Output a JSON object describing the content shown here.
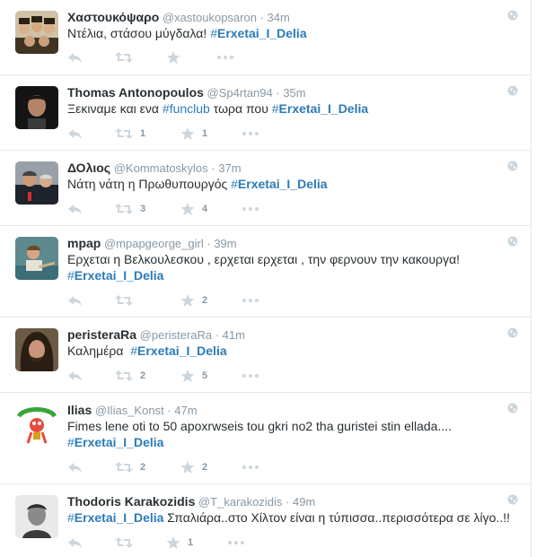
{
  "tweets": [
    {
      "fullname": "Χαστουκόψαρο",
      "username": "@xastoukopsaron",
      "time": "34m",
      "text_before": "Ντέλια, στάσου μύγδαλα! ",
      "hashtag1": "Erxetai_I_Delia",
      "text_middle": "",
      "hashtag2": "",
      "text_after": "",
      "retweets": "",
      "favorites": ""
    },
    {
      "fullname": "Thomas Antonopoulos",
      "username": "@Sp4rtan94",
      "time": "35m",
      "text_before": "Ξεκιναμε και ενα ",
      "hashtag1": "funclub",
      "text_middle": " τωρα που ",
      "hashtag2": "Erxetai_I_Delia",
      "text_after": "",
      "retweets": "1",
      "favorites": "1"
    },
    {
      "fullname": "ΔΟλιος",
      "username": "@Kommatoskylos",
      "time": "37m",
      "text_before": "Νάτη νάτη η Πρωθυπουργός ",
      "hashtag1": "Erxetai_I_Delia",
      "text_middle": "",
      "hashtag2": "",
      "text_after": "",
      "retweets": "3",
      "favorites": "4"
    },
    {
      "fullname": "mpap",
      "username": "@mpapgeorge_girl",
      "time": "39m",
      "text_before": "Ερχεται η Βελκουλεσκου , ερχεται ερχεται , την φερνουν την κακουργα!",
      "hashtag1": "Erxetai_I_Delia",
      "text_middle": "",
      "hashtag2": "",
      "text_after": "",
      "retweets": "",
      "favorites": "2"
    },
    {
      "fullname": "peristeraRa",
      "username": "@peristeraRa",
      "time": "41m",
      "text_before": "Καλημέρα  ",
      "hashtag1": "Erxetai_I_Delia",
      "text_middle": "",
      "hashtag2": "",
      "text_after": "",
      "retweets": "2",
      "favorites": "5"
    },
    {
      "fullname": "Ilias",
      "username": "@Ilias_Konst",
      "time": "47m",
      "text_before": "Fimes lene oti to 50 apoxrwseis tou gkri no2 tha guristei stin ellada....",
      "hashtag1": "Erxetai_I_Delia",
      "text_middle": "",
      "hashtag2": "",
      "text_after": "",
      "retweets": "2",
      "favorites": "2"
    },
    {
      "fullname": "Thodoris Karakozidis",
      "username": "@T_karakozidis",
      "time": "49m",
      "text_before": "",
      "hashtag1": "Erxetai_I_Delia",
      "text_middle": "",
      "hashtag2": "",
      "text_after": " Σπαλιάρα..στο Χίλτον είναι η τύπισσα..περισσότερα σε λίγο..!!",
      "retweets": "",
      "favorites": "1"
    }
  ],
  "colors": {
    "accent": "#2b7bb9",
    "meta": "#8899a6",
    "icon": "#ccd6dd",
    "divider": "#e1e8ed"
  },
  "icons": {
    "reply": "reply-icon",
    "retweet": "retweet-icon",
    "favorite": "star-icon",
    "more": "more-dots-icon",
    "globe": "globe-icon"
  }
}
